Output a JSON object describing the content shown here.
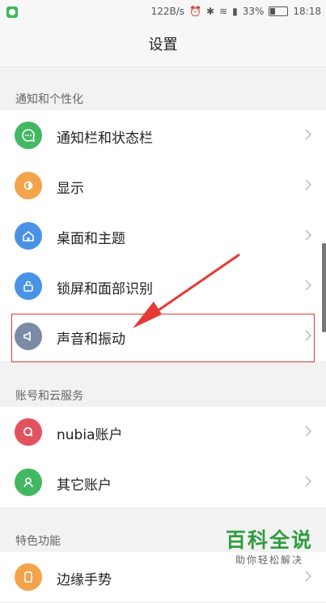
{
  "status_bar": {
    "speed": "122B/s",
    "battery_pct": "33%",
    "battery_level": 0.33,
    "time": "18:18"
  },
  "title": "设置",
  "sections": [
    {
      "header": "通知和个性化",
      "items": [
        {
          "label": "通知栏和状态栏",
          "icon": "message-icon",
          "color": "#43b862"
        },
        {
          "label": "显示",
          "icon": "brightness-icon",
          "color": "#f3a34b"
        },
        {
          "label": "桌面和主题",
          "icon": "home-icon",
          "color": "#4a92e6"
        },
        {
          "label": "锁屏和面部识别",
          "icon": "lock-icon",
          "color": "#4a92e6"
        },
        {
          "label": "声音和振动",
          "icon": "speaker-icon",
          "color": "#7b8aa6"
        }
      ]
    },
    {
      "header": "账号和云服务",
      "items": [
        {
          "label": "nubia账户",
          "icon": "nubia-icon",
          "color": "#e3535f"
        },
        {
          "label": "其它账户",
          "icon": "person-icon",
          "color": "#43b862"
        }
      ]
    },
    {
      "header": "特色功能",
      "items": [
        {
          "label": "边缘手势",
          "icon": "edge-icon",
          "color": "#f3a34b"
        }
      ]
    }
  ],
  "watermark": {
    "title": "百科全说",
    "subtitle": "助你轻松解决"
  }
}
